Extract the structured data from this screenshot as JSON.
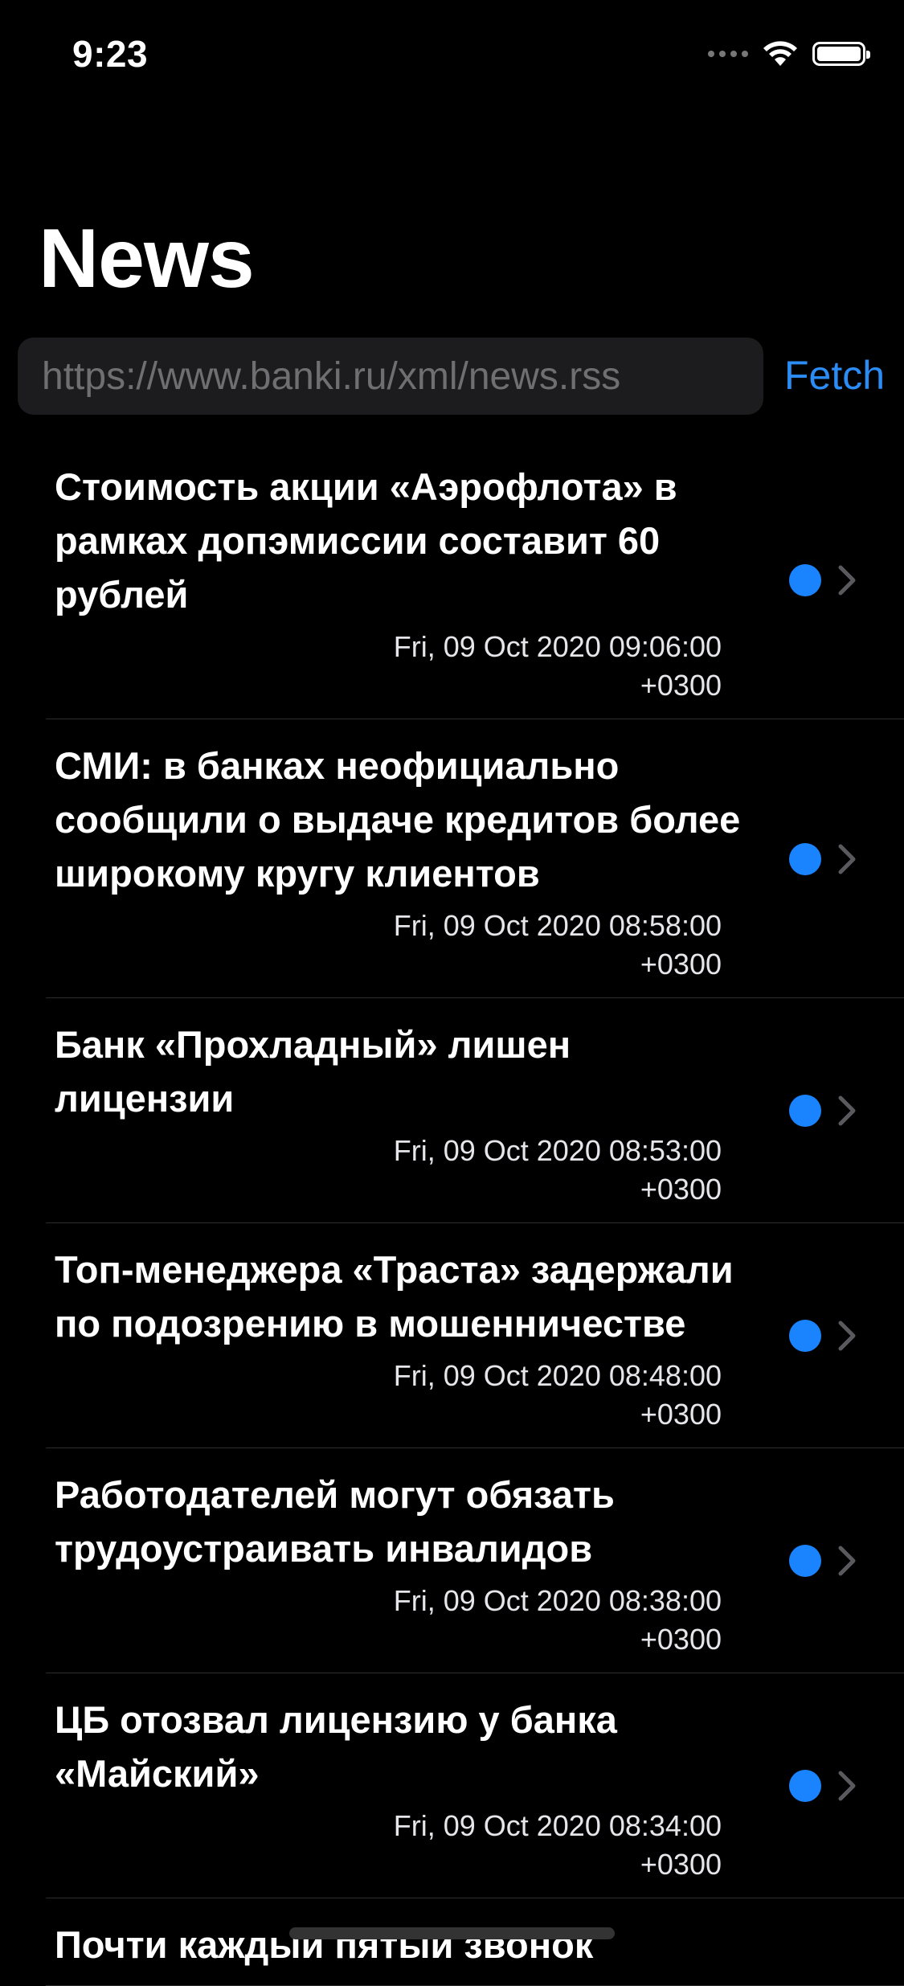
{
  "status_bar": {
    "time": "9:23"
  },
  "nav": {
    "title": "News"
  },
  "search": {
    "placeholder": "https://www.banki.ru/xml/news.rss",
    "value": ""
  },
  "fetch": {
    "label": "Fetch"
  },
  "colors": {
    "accent": "#2b8cf5",
    "dot": "#1a84ff",
    "background": "#000000",
    "field": "#1c1c1e"
  },
  "icons": {
    "chevron": "chevron-right-icon",
    "unread": "unread-dot-icon"
  },
  "news": [
    {
      "title": "Стоимость акции «Аэрофлота» в рамках допэмиссии составит 60 рублей",
      "date": "Fri, 09 Oct 2020 09:06:00",
      "tz": "+0300"
    },
    {
      "title": "СМИ: в банках неофициально сообщили о выдаче кредитов более широкому кругу клиентов",
      "date": "Fri, 09 Oct 2020 08:58:00",
      "tz": "+0300"
    },
    {
      "title": "Банк «Прохладный» лишен лицензии",
      "date": "Fri, 09 Oct 2020 08:53:00",
      "tz": "+0300"
    },
    {
      "title": "Топ-менеджера «Траста» задержали по подозрению в мошенничестве",
      "date": "Fri, 09 Oct 2020 08:48:00",
      "tz": "+0300"
    },
    {
      "title": "Работодателей могут обязать трудоустраивать инвалидов",
      "date": "Fri, 09 Oct 2020 08:38:00",
      "tz": "+0300"
    },
    {
      "title": "ЦБ отозвал лицензию у банка «Майский»",
      "date": "Fri, 09 Oct 2020 08:34:00",
      "tz": "+0300"
    },
    {
      "title": "Почти каждый пятый звонок",
      "date": "",
      "tz": ""
    }
  ]
}
